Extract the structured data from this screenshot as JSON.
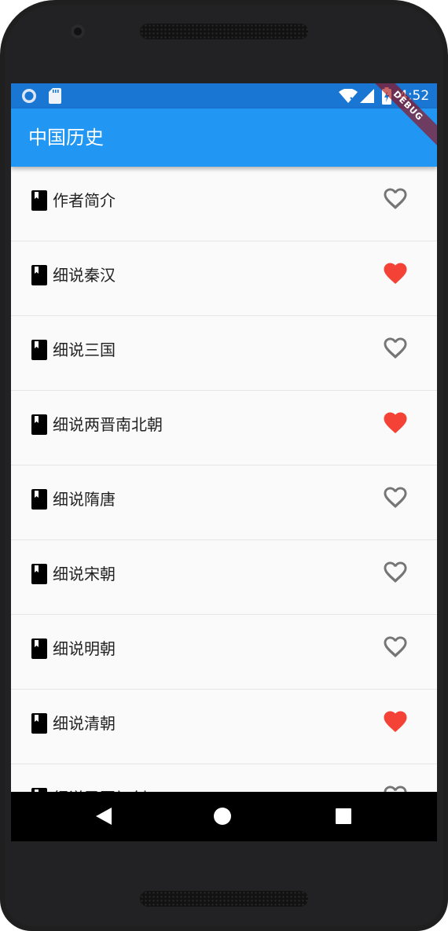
{
  "status_bar": {
    "time": "4:52",
    "icons": [
      "circle-notification-icon",
      "sd-card-icon",
      "wifi-icon",
      "signal-icon",
      "battery-icon"
    ],
    "color": "#1976d2"
  },
  "debug_banner": "DEBUG",
  "app_bar": {
    "title": "中国历史",
    "color": "#2196f3"
  },
  "list": {
    "items": [
      {
        "label": "作者简介",
        "favorite": false
      },
      {
        "label": "细说秦汉",
        "favorite": true
      },
      {
        "label": "细说三国",
        "favorite": false
      },
      {
        "label": "细说两晋南北朝",
        "favorite": true
      },
      {
        "label": "细说隋唐",
        "favorite": false
      },
      {
        "label": "细说宋朝",
        "favorite": false
      },
      {
        "label": "细说明朝",
        "favorite": false
      },
      {
        "label": "细说清朝",
        "favorite": true
      },
      {
        "label": "细说民国初创",
        "favorite": false
      }
    ],
    "favorite_color": "#f44336",
    "unfavorite_color": "#757575",
    "item_icon": "book-icon"
  },
  "nav_bar": {
    "buttons": [
      "back-icon",
      "home-icon",
      "recents-icon"
    ]
  }
}
